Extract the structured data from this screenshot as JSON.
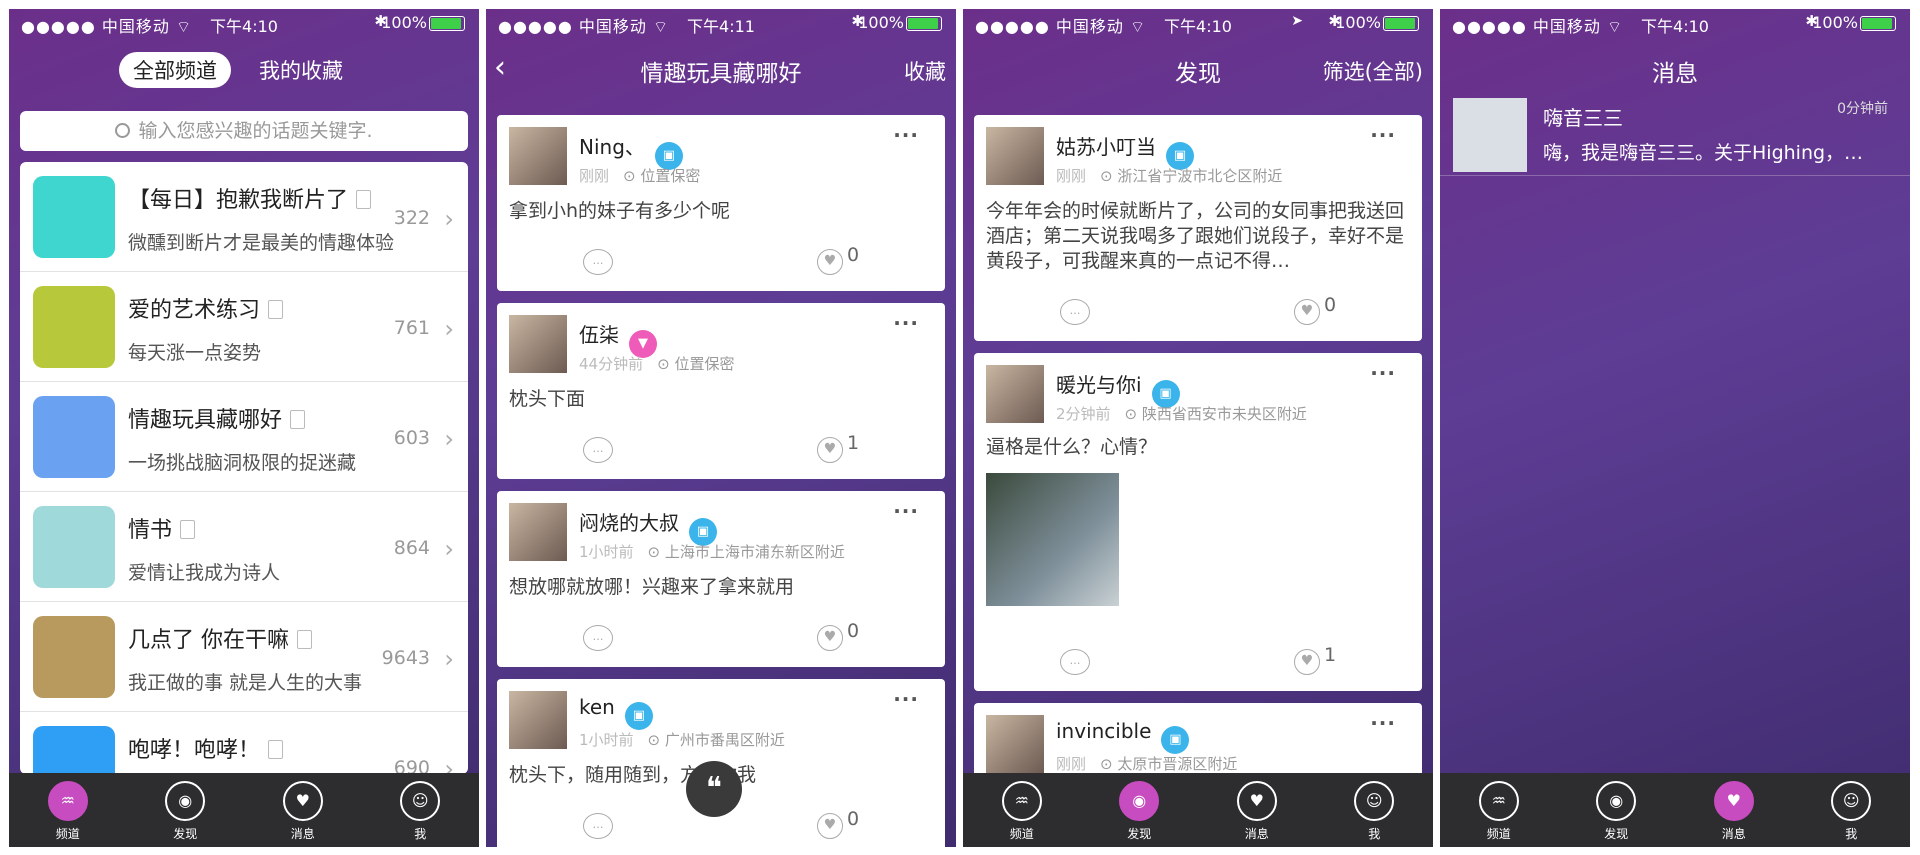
{
  "status": {
    "carrier": "中国移动",
    "battery": "100%",
    "times": [
      "下午4:10",
      "下午4:11",
      "下午4:10",
      "下午4:10"
    ]
  },
  "tabs": [
    "频道",
    "发现",
    "消息",
    "我"
  ],
  "screen1": {
    "segments": [
      "全部频道",
      "我的收藏"
    ],
    "search_placeholder": "输入您感兴趣的话题关键字.",
    "channels": [
      {
        "title": "【每日】抱歉我断片了",
        "desc": "微醺到断片才是最美的情趣体验",
        "count": "322",
        "color": "#3fd6d0"
      },
      {
        "title": "爱的艺术练习",
        "desc": "每天涨一点姿势",
        "count": "761",
        "color": "#b7c93a"
      },
      {
        "title": "情趣玩具藏哪好",
        "desc": "一场挑战脑洞极限的捉迷藏",
        "count": "603",
        "color": "#6aa1f0"
      },
      {
        "title": "情书",
        "desc": "爱情让我成为诗人",
        "count": "864",
        "color": "#9fd9d9"
      },
      {
        "title": "几点了 你在干嘛",
        "desc": "我正做的事 就是人生的大事",
        "count": "9643",
        "color": "#b89a5f"
      },
      {
        "title": "咆哮！咆哮！",
        "desc": "",
        "count": "690",
        "color": "#2f9ef5"
      }
    ]
  },
  "screen2": {
    "title": "情趣玩具藏哪好",
    "right": "收藏",
    "posts": [
      {
        "name": "Ning、",
        "time": "刚刚",
        "loc": "位置保密",
        "text": "拿到小h的妹子有多少个呢",
        "likes": "0"
      },
      {
        "name": "伍柒",
        "time": "44分钟前",
        "loc": "位置保密",
        "text": "枕头下面",
        "likes": "1"
      },
      {
        "name": "闷烧的大叔",
        "time": "1小时前",
        "loc": "上海市上海市浦东新区附近",
        "text": "想放哪就放哪！兴趣来了拿来就用",
        "likes": "0"
      },
      {
        "name": "ken",
        "time": "1小时前",
        "loc": "广州市番禺区附近",
        "text": "枕头下，随用随到，方便你我",
        "likes": "0"
      }
    ]
  },
  "screen3": {
    "title": "发现",
    "right": "筛选(全部)",
    "posts": [
      {
        "name": "姑苏小叮当",
        "time": "刚刚",
        "loc": "浙江省宁波市北仑区附近",
        "text": "今年年会的时候就断片了，公司的女同事把我送回酒店；第二天说我喝多了跟她们说段子，幸好不是黄段子，可我醒来真的一点记不得…",
        "likes": "0"
      },
      {
        "name": "暖光与你i",
        "time": "2分钟前",
        "loc": "陕西省西安市未央区附近",
        "text": "逼格是什么？心情？",
        "likes": "1"
      },
      {
        "name": "invincible",
        "time": "刚刚",
        "loc": "太原市晋源区附近",
        "text": "",
        "likes": ""
      }
    ]
  },
  "screen4": {
    "title": "消息",
    "message": {
      "name": "嗨音三三",
      "time": "0分钟前",
      "preview": "嗨，我是嗨音三三。关于Highing，…"
    }
  }
}
